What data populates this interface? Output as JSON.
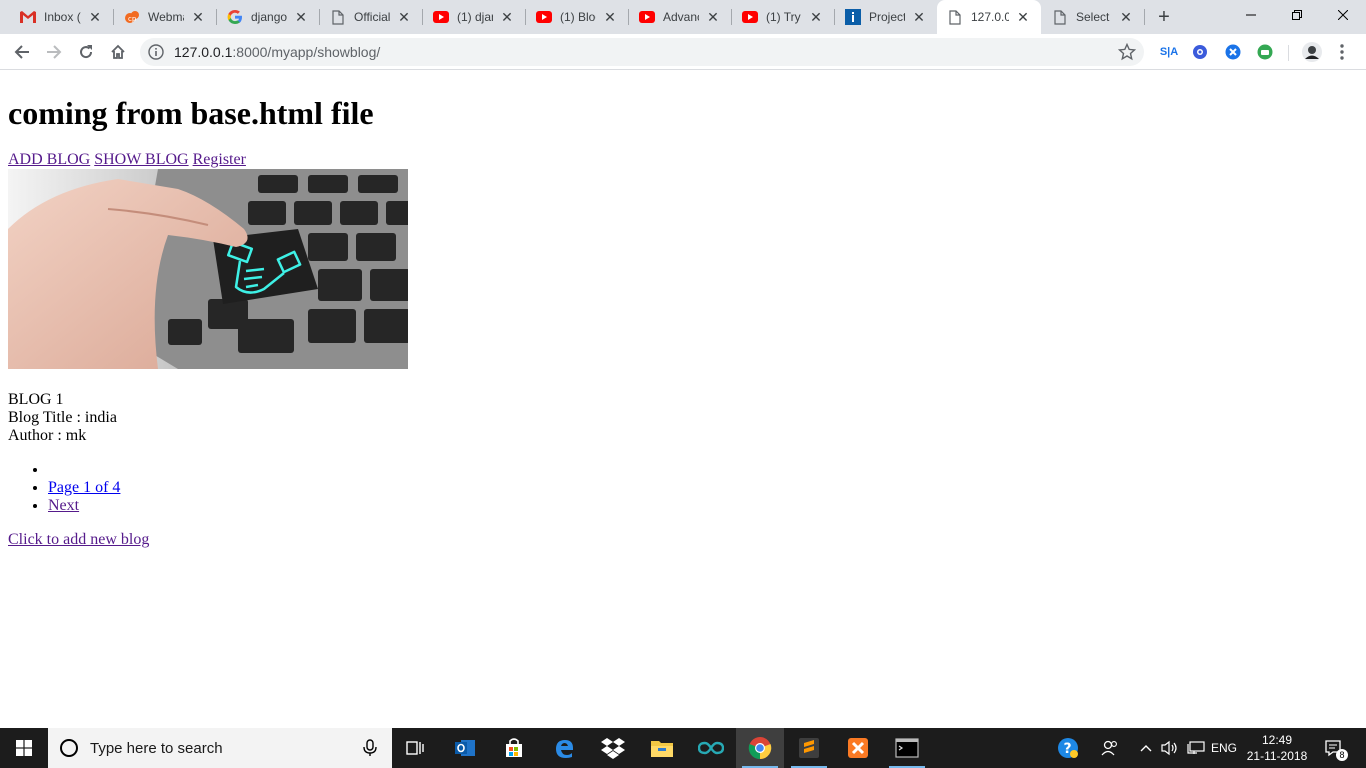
{
  "browser": {
    "tabs": [
      {
        "title": "Inbox (",
        "icon": "gmail-icon"
      },
      {
        "title": "Webma",
        "icon": "webmail-icon"
      },
      {
        "title": "django",
        "icon": "google-icon"
      },
      {
        "title": "Official",
        "icon": "page-icon"
      },
      {
        "title": "(1) djan",
        "icon": "youtube-icon"
      },
      {
        "title": "(1) Blog",
        "icon": "youtube-icon"
      },
      {
        "title": "Advanc",
        "icon": "youtube-icon"
      },
      {
        "title": "(1) Try",
        "icon": "youtube-icon"
      },
      {
        "title": "Project",
        "icon": "project-icon"
      },
      {
        "title": "127.0.0",
        "icon": "page-icon",
        "active": true
      },
      {
        "title": "Select",
        "icon": "page-icon"
      }
    ],
    "address": {
      "host": "127.0.0.1",
      "path": ":8000/myapp/showblog/"
    },
    "extensions": [
      "S|A",
      "ext-globe",
      "ext-x",
      "ext-green"
    ]
  },
  "page": {
    "heading": "coming from base.html file",
    "nav": {
      "add_blog": "ADD BLOG",
      "show_blog": "SHOW BLOG",
      "register": "Register"
    },
    "blog": {
      "number": "BLOG 1",
      "title_line": "Blog Title : india",
      "author_line": "Author : mk"
    },
    "pager": {
      "empty_item": "",
      "page_label": "Page 1 of 4",
      "next_label": "Next"
    },
    "add_link": "Click to add new blog"
  },
  "taskbar": {
    "search_placeholder": "Type here to search",
    "language": "ENG",
    "time": "12:49",
    "date": "21-11-2018",
    "notification_count": "8"
  }
}
